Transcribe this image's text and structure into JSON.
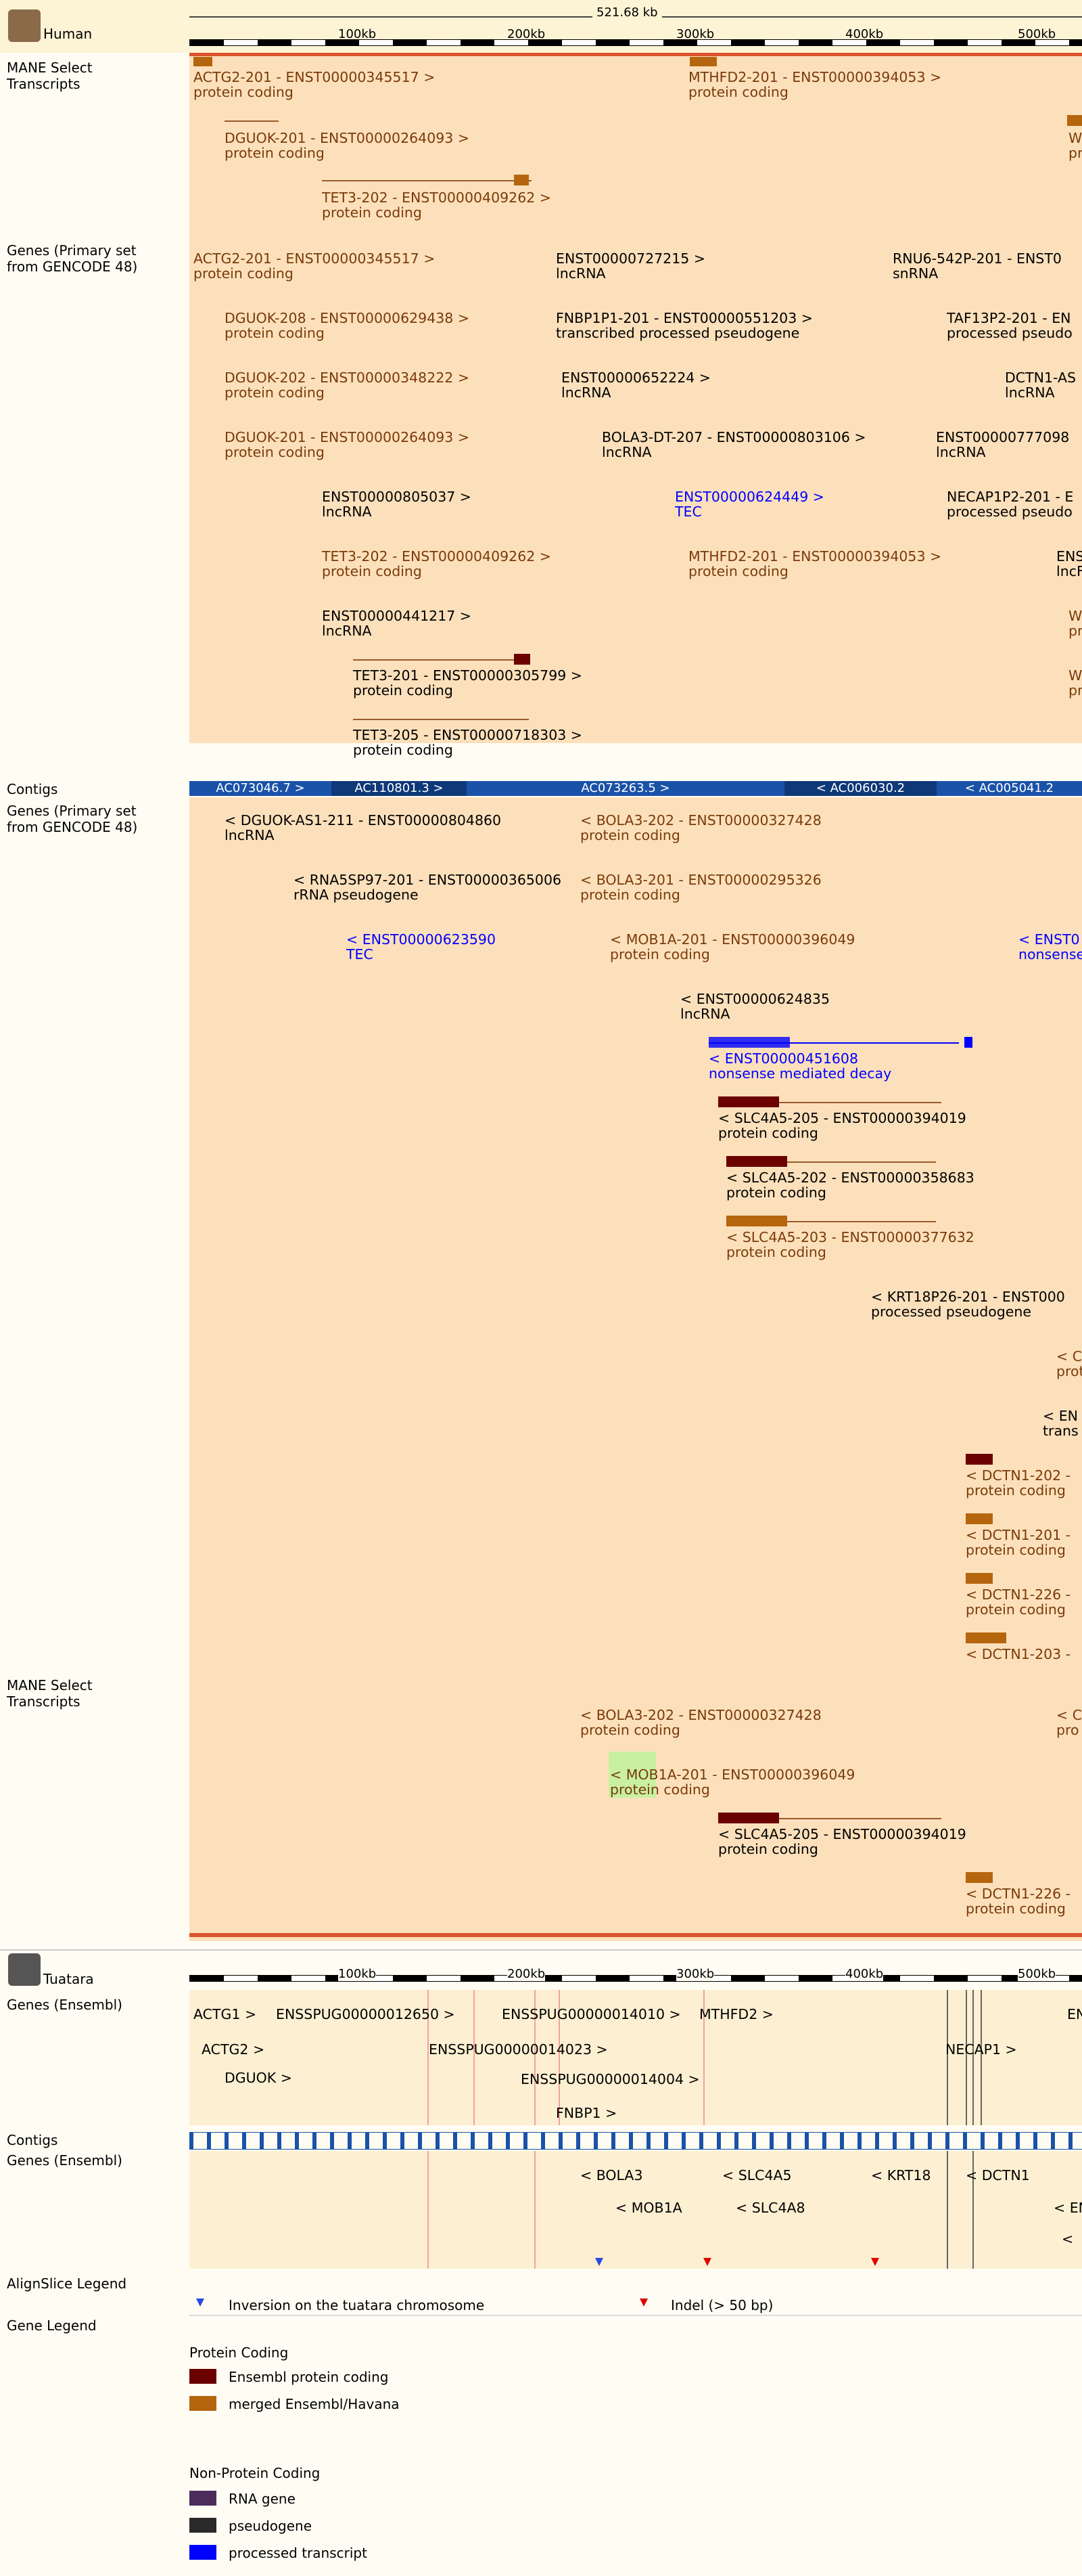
{
  "human": {
    "species": "Human",
    "ruler": {
      "span": "521.68 kb",
      "ticks": [
        "100kb",
        "200kb",
        "300kb",
        "400kb",
        "500kb"
      ]
    },
    "tracks": {
      "mane_top": "MANE Select\nTranscripts",
      "genes_primary": "Genes (Primary set\nfrom GENCODE 48)",
      "contigs": "Contigs",
      "genes_primary_rev": "Genes (Primary set\nfrom GENCODE 48)",
      "mane_bottom": "MANE Select\nTranscripts"
    },
    "mane_top": [
      {
        "name": "ACTG2-201 - ENST00000345517 >",
        "type": "protein coding"
      },
      {
        "name": "MTHFD2-201 - ENST00000394053 >",
        "type": "protein coding"
      },
      {
        "name": "DGUOK-201 - ENST00000264093 >",
        "type": "protein coding"
      },
      {
        "name": "TET3-202 - ENST00000409262 >",
        "type": "protein coding"
      },
      {
        "name": "W",
        "type": "pr"
      }
    ],
    "genes_fwd": [
      {
        "name": "ACTG2-201 - ENST00000345517 >",
        "type": "protein coding"
      },
      {
        "name": "ENST00000727215 >",
        "type": "lncRNA"
      },
      {
        "name": "RNU6-542P-201 - ENST0",
        "type": "snRNA"
      },
      {
        "name": "DGUOK-208 - ENST00000629438 >",
        "type": "protein coding"
      },
      {
        "name": "FNBP1P1-201 - ENST00000551203 >",
        "type": "transcribed processed pseudogene"
      },
      {
        "name": "TAF13P2-201 - EN",
        "type": "processed pseudo"
      },
      {
        "name": "DGUOK-202 - ENST00000348222 >",
        "type": "protein coding"
      },
      {
        "name": "ENST00000652224 >",
        "type": "lncRNA"
      },
      {
        "name": "DCTN1-AS",
        "type": "lncRNA"
      },
      {
        "name": "DGUOK-201 - ENST00000264093 >",
        "type": "protein coding"
      },
      {
        "name": "BOLA3-DT-207 - ENST00000803106 >",
        "type": "lncRNA"
      },
      {
        "name": "ENST00000777098",
        "type": "lncRNA"
      },
      {
        "name": "ENST00000805037 >",
        "type": "lncRNA"
      },
      {
        "name": "ENST00000624449 >",
        "type": "TEC"
      },
      {
        "name": "NECAP1P2-201 - E",
        "type": "processed pseudo"
      },
      {
        "name": "TET3-202 - ENST00000409262 >",
        "type": "protein coding"
      },
      {
        "name": "MTHFD2-201 - ENST00000394053 >",
        "type": "protein coding"
      },
      {
        "name": "ENS",
        "type": "lncF"
      },
      {
        "name": "ENST00000441217 >",
        "type": "lncRNA"
      },
      {
        "name": "W",
        "type": "pr"
      },
      {
        "name": "TET3-201 - ENST00000305799 >",
        "type": "protein coding"
      },
      {
        "name": "W",
        "type": "pr"
      },
      {
        "name": "TET3-205 - ENST00000718303 >",
        "type": "protein coding"
      }
    ],
    "contigs": [
      "AC073046.7 >",
      "AC110801.3 >",
      "AC073263.5 >",
      "< AC006030.2",
      "< AC005041.2"
    ],
    "genes_rev": [
      {
        "name": "< DGUOK-AS1-211 - ENST00000804860",
        "type": "lncRNA"
      },
      {
        "name": "< BOLA3-202 - ENST00000327428",
        "type": "protein coding"
      },
      {
        "name": "< RNA5SP97-201 - ENST00000365006",
        "type": "rRNA pseudogene"
      },
      {
        "name": "< BOLA3-201 - ENST00000295326",
        "type": "protein coding"
      },
      {
        "name": "< ENST00000623590",
        "type": "TEC"
      },
      {
        "name": "< MOB1A-201 - ENST00000396049",
        "type": "protein coding"
      },
      {
        "name": "< ENST0",
        "type": "nonsense"
      },
      {
        "name": "< ENST00000624835",
        "type": "lncRNA"
      },
      {
        "name": "< ENST00000451608",
        "type": "nonsense mediated decay"
      },
      {
        "name": "< SLC4A5-205 - ENST00000394019",
        "type": "protein coding"
      },
      {
        "name": "< SLC4A5-202 - ENST00000358683",
        "type": "protein coding"
      },
      {
        "name": "< SLC4A5-203 - ENST00000377632",
        "type": "protein coding"
      },
      {
        "name": "< KRT18P26-201 - ENST000",
        "type": "processed pseudogene"
      },
      {
        "name": "< DCTN1-202 -",
        "type": "protein coding"
      },
      {
        "name": "< DCTN1-201 -",
        "type": "protein coding"
      },
      {
        "name": "< DCTN1-226 -",
        "type": "protein coding"
      },
      {
        "name": "< DCTN1-203 -",
        "type": "protein coding"
      },
      {
        "name": "< C",
        "type": "prot"
      },
      {
        "name": "< EN",
        "type": "trans"
      }
    ],
    "mane_bottom": [
      {
        "name": "< BOLA3-202 - ENST00000327428",
        "type": "protein coding"
      },
      {
        "name": "< MOB1A-201 - ENST00000396049",
        "type": "protein coding"
      },
      {
        "name": "< SLC4A5-205 - ENST00000394019",
        "type": "protein coding"
      },
      {
        "name": "< DCTN1-226 -",
        "type": "protein coding"
      },
      {
        "name": "< C",
        "type": "pro"
      }
    ]
  },
  "tuatara": {
    "species": "Tuatara",
    "ruler": {
      "ticks": [
        "100kb",
        "200kb",
        "300kb",
        "400kb",
        "500kb"
      ]
    },
    "tracks": {
      "genes_ens": "Genes (Ensembl)",
      "contigs": "Contigs",
      "genes_ens_rev": "Genes (Ensembl)"
    },
    "genes_fwd": [
      "ACTG1 >",
      "ENSSPUG00000012650 >",
      "ENSSPUG00000014010 >",
      "MTHFD2 >",
      "EN",
      "ACTG2 >",
      "ENSSPUG00000014023 >",
      "NECAP1 >",
      "DGUOK >",
      "ENSSPUG00000014004 >",
      "FNBP1 >"
    ],
    "genes_rev": [
      "< BOLA3",
      "< SLC4A5",
      "< KRT18",
      "< DCTN1",
      "< MOB1A",
      "< SLC4A8",
      "< EN",
      "< "
    ]
  },
  "align_legend": {
    "title": "AlignSlice Legend",
    "inversion": "Inversion on the tuatara chromosome",
    "indel": "Indel (> 50 bp)"
  },
  "gene_legend": {
    "title": "Gene Legend",
    "protein_heading": "Protein Coding",
    "items_protein": [
      {
        "label": "Ensembl protein coding",
        "color": "#6a0000"
      },
      {
        "label": "merged Ensembl/Havana",
        "color": "#b5650d"
      }
    ],
    "noncoding_heading": "Non-Protein Coding",
    "items_noncoding": [
      {
        "label": "RNA gene",
        "color": "#4d2c5c"
      },
      {
        "label": "pseudogene",
        "color": "#2a2a2a"
      },
      {
        "label": "processed transcript",
        "color": "#0000ff"
      }
    ]
  }
}
